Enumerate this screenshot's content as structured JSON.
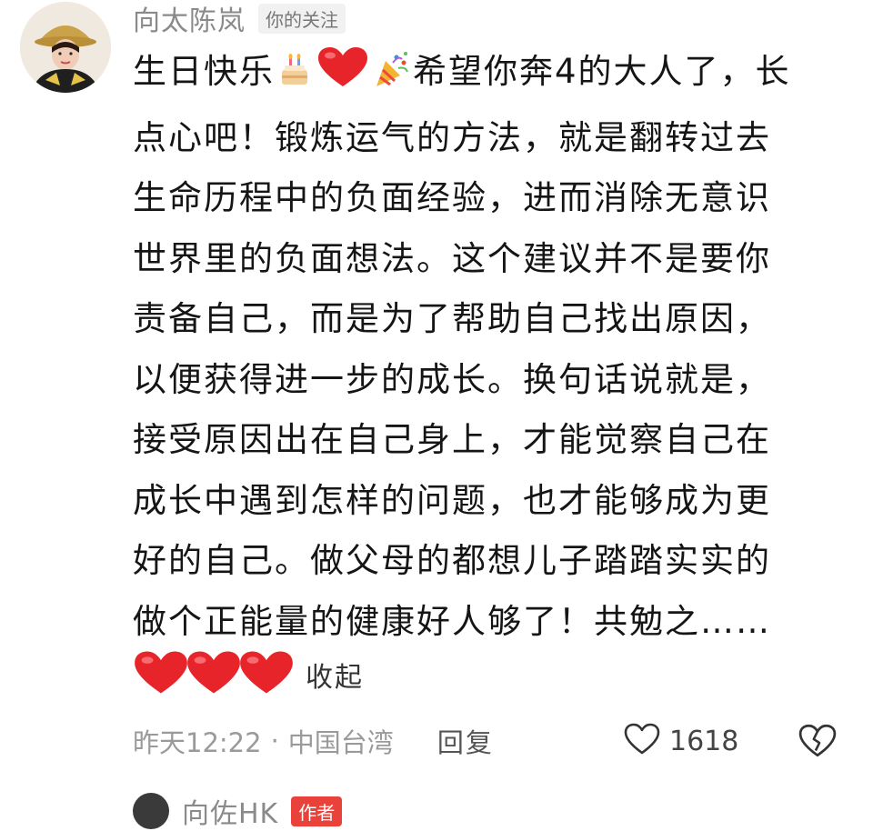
{
  "comment": {
    "author": "向太陈岚",
    "follow_badge": "你的关注",
    "lines": {
      "l1_a": "生日快乐",
      "l1_b": "希望你奔4的大人了，长",
      "l2": "点心吧！锻炼运气的方法，就是翻转过去",
      "l3": "生命历程中的负面经验，进而消除无意识",
      "l4": "世界里的负面想法。这个建议并不是要你",
      "l5": "责备自己，而是为了帮助自己找出原因，",
      "l6": "以便获得进一步的成长。换句话说就是，",
      "l7": "接受原因出在自己身上，才能觉察自己在",
      "l8": "成长中遇到怎样的问题，也才能够成为更",
      "l9": "好的自己。做父母的都想儿子踏踏实实的",
      "l10": "做个正能量的健康好人够了！共勉之……"
    },
    "emojis": [
      "birthday-cake-icon",
      "red-heart-icon",
      "party-popper-icon"
    ],
    "reaction_hearts": [
      "red-heart-icon",
      "red-heart-icon",
      "red-heart-icon"
    ],
    "collapse_label": "收起",
    "time": "昨天12:22",
    "separator": "·",
    "location": "中国台湾",
    "reply_label": "回复",
    "like_count": "1618",
    "heart_color": "#e8242b"
  },
  "reply_preview": {
    "author": "向佐HK",
    "badge": "作者"
  }
}
